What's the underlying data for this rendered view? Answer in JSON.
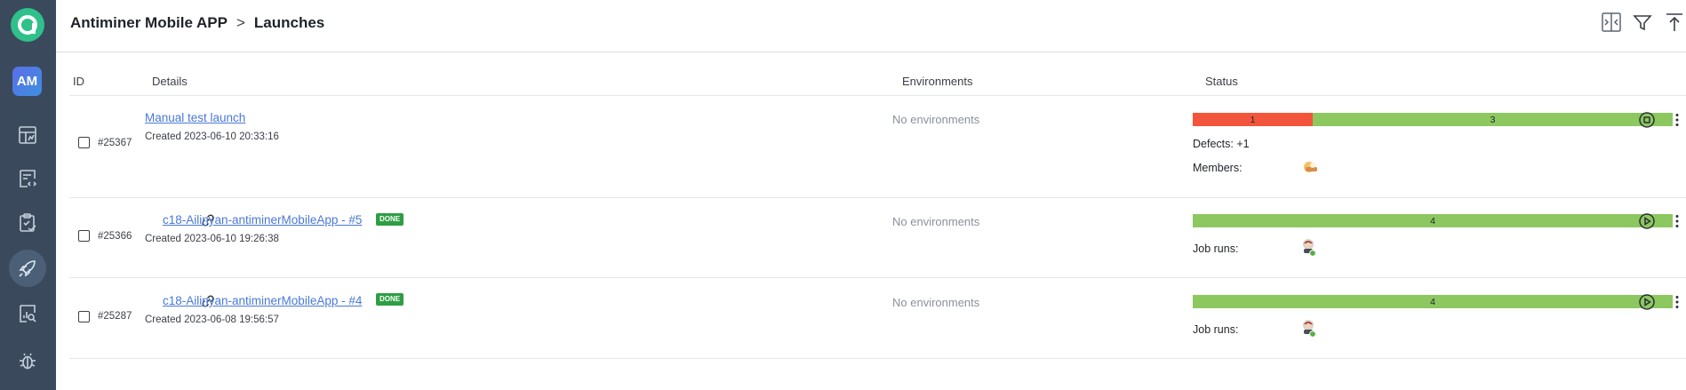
{
  "sidebar": {
    "avatar_label": "AM",
    "items": [
      {
        "icon": "dashboard-icon"
      },
      {
        "icon": "test-cases-icon"
      },
      {
        "icon": "test-plans-icon"
      },
      {
        "icon": "launches-icon",
        "active": true
      },
      {
        "icon": "analytics-icon"
      },
      {
        "icon": "defects-icon"
      }
    ]
  },
  "header": {
    "project": "Antiminer Mobile APP",
    "separator": ">",
    "page": "Launches",
    "icons": [
      "collapse-icon",
      "filter-icon",
      "upload-icon"
    ]
  },
  "columns": {
    "id": "ID",
    "details": "Details",
    "environments": "Environments",
    "status": "Status"
  },
  "launches": [
    {
      "id": "#25367",
      "title": "Manual test launch",
      "created": "Created 2023-06-10 20:33:16",
      "environments": "No environments",
      "status_bar": [
        {
          "label": "1",
          "value": 1,
          "color": "#f2553c"
        },
        {
          "label": "3",
          "value": 3,
          "color": "#8cc85f"
        }
      ],
      "defects_label": "Defects:",
      "defects_value": "+1",
      "members_label": "Members:",
      "action": "stop-icon"
    },
    {
      "id": "#25366",
      "title": "c18-Ailinyan-antiminerMobileApp - #5",
      "badge": "DONE",
      "created": "Created 2023-06-10 19:26:38",
      "environments": "No environments",
      "status_bar": [
        {
          "label": "4",
          "value": 4,
          "color": "#8cc85f"
        }
      ],
      "job_runs_label": "Job runs:",
      "action": "play-icon"
    },
    {
      "id": "#25287",
      "title": "c18-Ailinyan-antiminerMobileApp - #4",
      "badge": "DONE",
      "created": "Created 2023-06-08 19:56:57",
      "environments": "No environments",
      "status_bar": [
        {
          "label": "4",
          "value": 4,
          "color": "#8cc85f"
        }
      ],
      "job_runs_label": "Job runs:",
      "action": "play-icon"
    }
  ],
  "colors": {
    "sidebar": "#3a4a5c",
    "brand": "#2fc08b",
    "link": "#4a78d9",
    "failed": "#f2553c",
    "passed": "#8cc85f",
    "done_badge": "#2e9e45"
  }
}
